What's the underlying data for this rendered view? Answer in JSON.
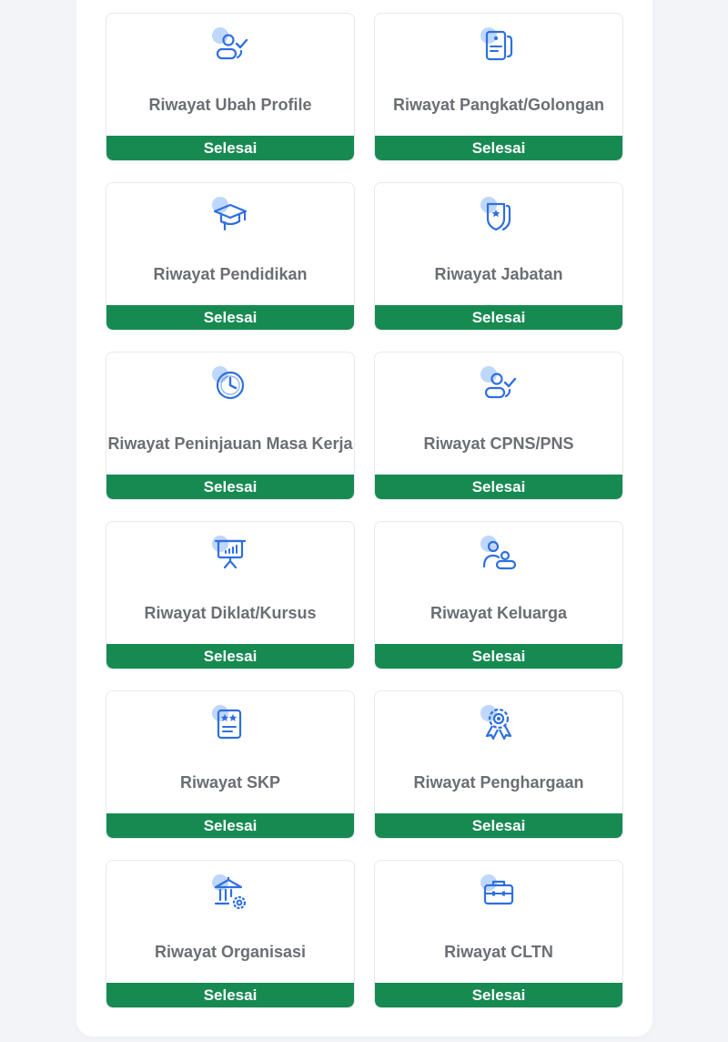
{
  "colors": {
    "status_bg": "#178a52",
    "icon_blue": "#2f6fe0",
    "icon_bubble": "#bfd7fb",
    "title_text": "#6b6e73"
  },
  "cards": [
    {
      "title": "Riwayat Ubah Profile",
      "status": "Selesai",
      "icon": "user-check-icon"
    },
    {
      "title": "Riwayat Pangkat/Golongan",
      "status": "Selesai",
      "icon": "id-card-icon"
    },
    {
      "title": "Riwayat Pendidikan",
      "status": "Selesai",
      "icon": "graduation-cap-icon"
    },
    {
      "title": "Riwayat Jabatan",
      "status": "Selesai",
      "icon": "badge-icon"
    },
    {
      "title": "Riwayat Peninjauan Masa Kerja",
      "status": "Selesai",
      "icon": "clock-icon"
    },
    {
      "title": "Riwayat CPNS/PNS",
      "status": "Selesai",
      "icon": "user-check-icon"
    },
    {
      "title": "Riwayat Diklat/Kursus",
      "status": "Selesai",
      "icon": "presentation-board-icon"
    },
    {
      "title": "Riwayat Keluarga",
      "status": "Selesai",
      "icon": "family-icon"
    },
    {
      "title": "Riwayat SKP",
      "status": "Selesai",
      "icon": "star-document-icon"
    },
    {
      "title": "Riwayat Penghargaan",
      "status": "Selesai",
      "icon": "award-ribbon-icon"
    },
    {
      "title": "Riwayat Organisasi",
      "status": "Selesai",
      "icon": "institution-gear-icon"
    },
    {
      "title": "Riwayat CLTN",
      "status": "Selesai",
      "icon": "briefcase-icon"
    }
  ]
}
